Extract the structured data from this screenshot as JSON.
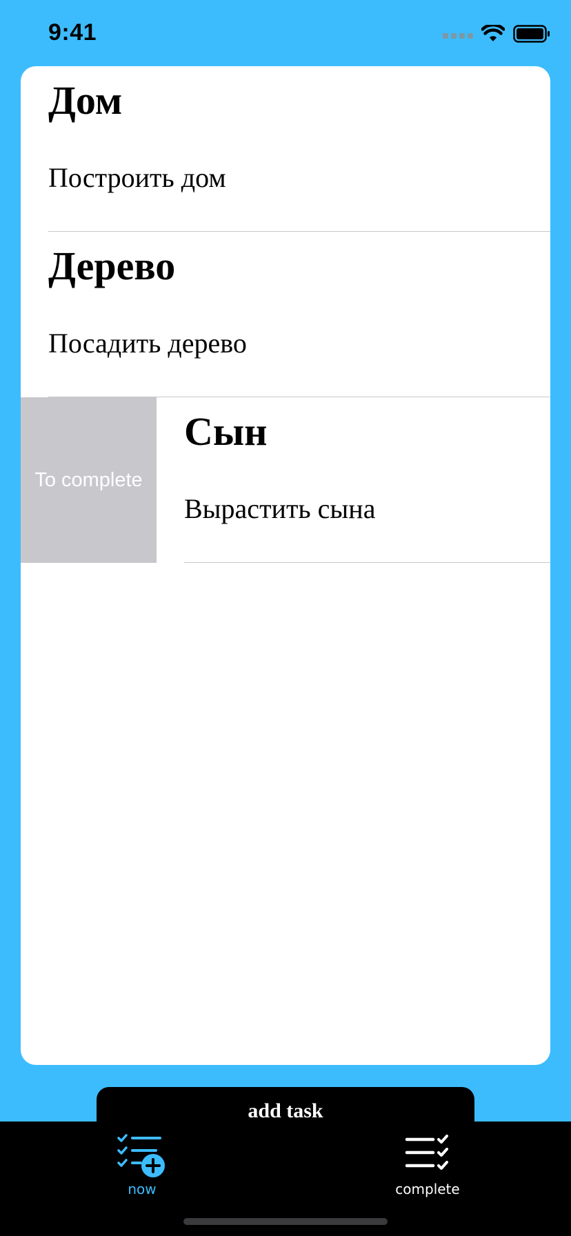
{
  "status_bar": {
    "time": "9:41"
  },
  "tasks": [
    {
      "title": "Дом",
      "subtitle": "Построить дом"
    },
    {
      "title": "Дерево",
      "subtitle": "Посадить дерево"
    },
    {
      "title": "Сын",
      "subtitle": "Вырастить сына"
    }
  ],
  "swipe_action": {
    "label": "To complete"
  },
  "add_task": {
    "label": "add task"
  },
  "tabs": [
    {
      "label": "now",
      "icon": "checklist-add-icon",
      "selected": true
    },
    {
      "label": "complete",
      "icon": "checklist-done-icon",
      "selected": false
    }
  ],
  "colors": {
    "background": "#3DBCFD",
    "accent": "#3DBCFD",
    "swipe_action": "#C7C7CC",
    "tab_bar": "#000000"
  }
}
